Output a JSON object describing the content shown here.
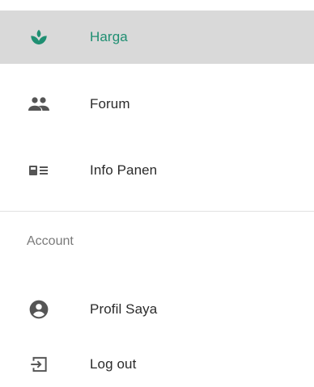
{
  "nav": {
    "items": [
      {
        "label": "Harga",
        "icon": "sprout-icon",
        "active": true
      },
      {
        "label": "Forum",
        "icon": "people-icon",
        "active": false
      },
      {
        "label": "Info Panen",
        "icon": "news-icon",
        "active": false
      }
    ]
  },
  "account": {
    "section_title": "Account",
    "items": [
      {
        "label": "Profil Saya",
        "icon": "account-circle-icon"
      },
      {
        "label": "Log out",
        "icon": "logout-icon"
      }
    ]
  },
  "colors": {
    "accent": "#1f8f72",
    "active_bg": "#d9d9d9",
    "icon": "#555555"
  }
}
